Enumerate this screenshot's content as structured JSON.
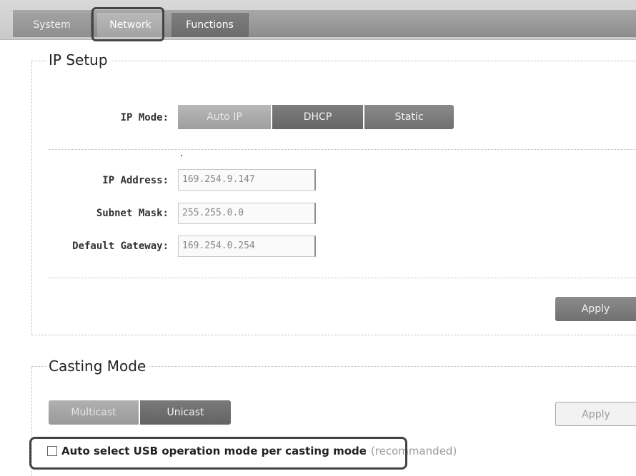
{
  "tabs": [
    {
      "label": "System"
    },
    {
      "label": "Network"
    },
    {
      "label": "Functions"
    }
  ],
  "ip_setup": {
    "title": "IP Setup",
    "mode_label": "IP Mode:",
    "modes": [
      {
        "label": "Auto IP",
        "selected": true
      },
      {
        "label": "DHCP",
        "selected": false
      },
      {
        "label": "Static",
        "selected": false
      }
    ],
    "fields": [
      {
        "label": "IP Address:",
        "value": "169.254.9.147"
      },
      {
        "label": "Subnet Mask:",
        "value": "255.255.0.0"
      },
      {
        "label": "Default Gateway:",
        "value": "169.254.0.254"
      }
    ],
    "apply_label": "Apply"
  },
  "casting_mode": {
    "title": "Casting Mode",
    "modes": [
      {
        "label": "Multicast",
        "selected": true
      },
      {
        "label": "Unicast",
        "selected": false
      }
    ],
    "apply_label": "Apply",
    "usb_checkbox": {
      "label": "Auto select USB operation mode per casting mode",
      "note": "(recommanded)",
      "checked": false
    }
  }
}
